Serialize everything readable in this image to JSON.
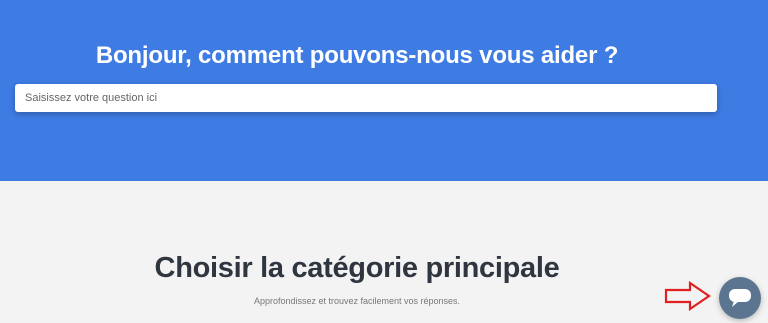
{
  "hero": {
    "title": "Bonjour, comment pouvons-nous vous aider ?",
    "background_color": "#3e7be2"
  },
  "search": {
    "placeholder": "Saisissez votre question ici",
    "value": ""
  },
  "categories": {
    "title": "Choisir la catégorie principale",
    "subtitle": "Approfondissez et trouvez facilement vos réponses."
  },
  "annotation": {
    "icon": "arrow-right-icon",
    "color": "#e02020"
  },
  "chat_launcher": {
    "icon": "chat-bubble-icon",
    "color": "#5b7590"
  }
}
